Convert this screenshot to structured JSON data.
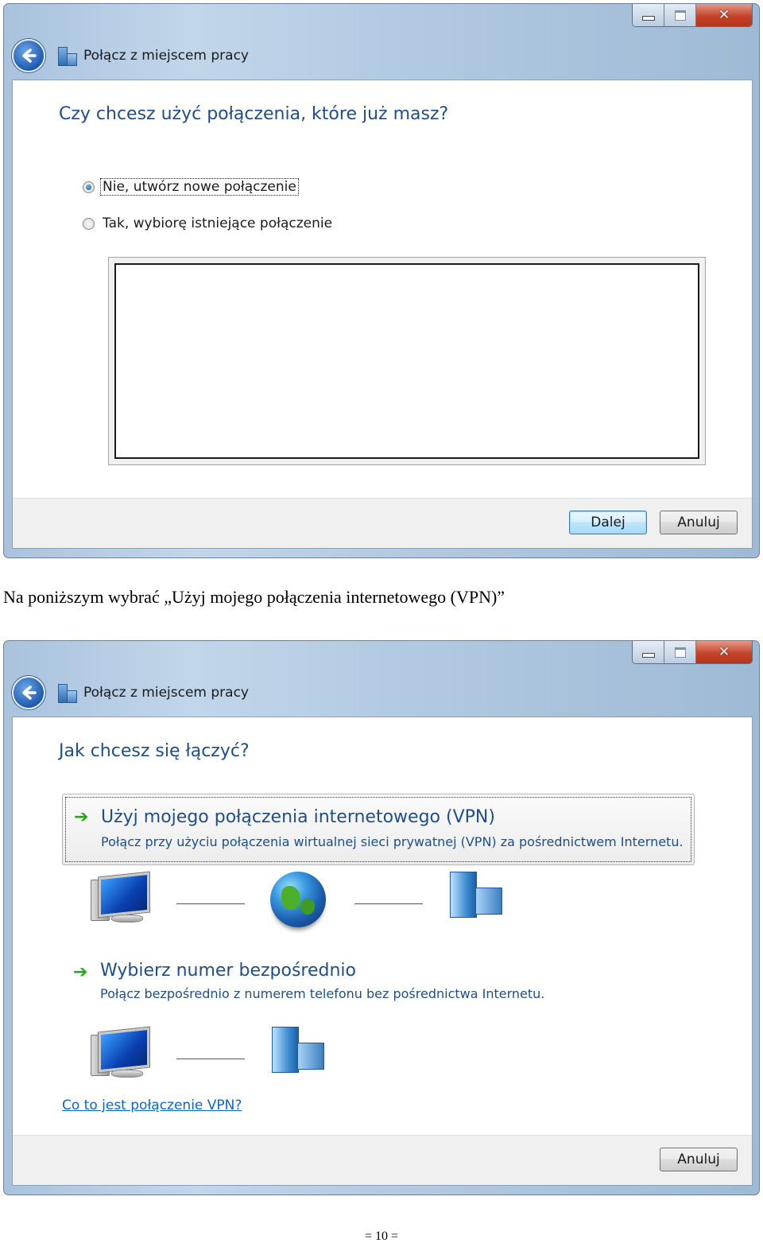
{
  "window1": {
    "title": "Połącz z miejscem pracy",
    "question": "Czy chcesz użyć połączenia, które już masz?",
    "radio_options": [
      {
        "label": "Nie, utwórz nowe połączenie",
        "selected": true
      },
      {
        "label": "Tak, wybiorę istniejące połączenie",
        "selected": false
      }
    ],
    "buttons": {
      "next": "Dalej",
      "cancel": "Anuluj"
    }
  },
  "caption": "Na poniższym wybrać „Użyj mojego połączenia internetowego (VPN)”",
  "window2": {
    "title": "Połącz z miejscem pracy",
    "question": "Jak chcesz się łączyć?",
    "options": [
      {
        "title": "Użyj mojego połączenia internetowego (VPN)",
        "description": "Połącz przy użyciu połączenia wirtualnej sieci prywatnej (VPN) za pośrednictwem Internetu."
      },
      {
        "title": "Wybierz numer bezpośrednio",
        "description": "Połącz bezpośrednio z numerem telefonu bez pośrednictwa Internetu."
      }
    ],
    "help_link": "Co to jest połączenie VPN?",
    "buttons": {
      "cancel": "Anuluj"
    }
  },
  "caption_buttons": {
    "minimize": "minimize-icon",
    "maximize": "maximize-icon",
    "close": "close-icon"
  },
  "colors": {
    "instruction_blue": "#1e4e8c",
    "link_blue": "#0a66cc",
    "arrow_green": "#2aa61c"
  },
  "page_number": "= 10 ="
}
